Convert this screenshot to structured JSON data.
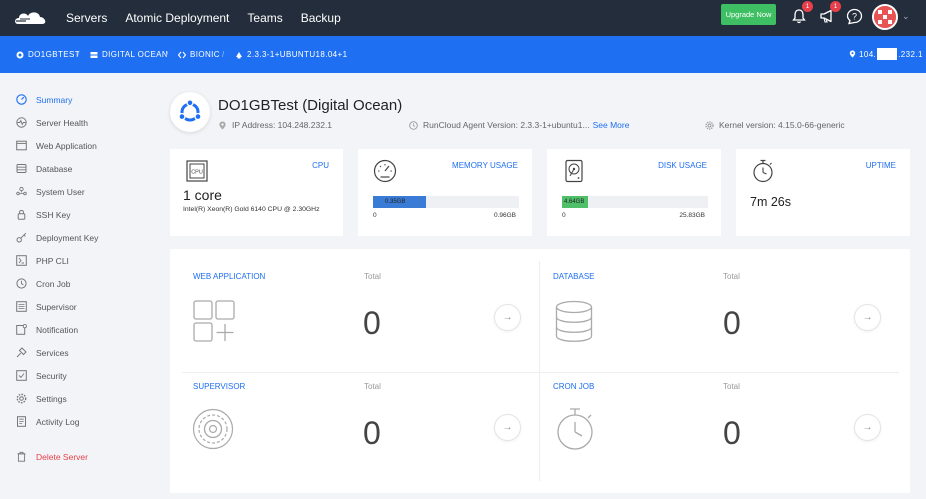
{
  "nav": {
    "links": [
      "Servers",
      "Atomic Deployment",
      "Teams",
      "Backup"
    ],
    "upgrade_label": "Upgrade Now",
    "notif_badge": "1",
    "announce_badge": "1",
    "icons": [
      "bell-icon",
      "megaphone-icon",
      "help-icon",
      "avatar",
      "chevron-down-icon"
    ]
  },
  "breadcrumb": {
    "server": "DO1GBTEST",
    "provider": "DIGITAL OCEAN",
    "os": "BIONIC",
    "agent": "2.3.3-1+UBUNTU18.04+1",
    "ip_prefix": "104.",
    "ip_suffix": ".232.1"
  },
  "sidebar": {
    "items": [
      {
        "label": "Summary",
        "icon": "gauge-icon"
      },
      {
        "label": "Server Health",
        "icon": "heartbeat-icon"
      },
      {
        "label": "Web Application",
        "icon": "browser-icon"
      },
      {
        "label": "Database",
        "icon": "database-icon"
      },
      {
        "label": "System User",
        "icon": "users-icon"
      },
      {
        "label": "SSH Key",
        "icon": "lock-icon"
      },
      {
        "label": "Deployment Key",
        "icon": "key-icon"
      },
      {
        "label": "PHP CLI",
        "icon": "php-icon"
      },
      {
        "label": "Cron Job",
        "icon": "clock-icon"
      },
      {
        "label": "Supervisor",
        "icon": "list-icon"
      },
      {
        "label": "Notification",
        "icon": "notification-icon"
      },
      {
        "label": "Services",
        "icon": "plug-icon"
      },
      {
        "label": "Security",
        "icon": "shield-icon"
      },
      {
        "label": "Settings",
        "icon": "gear-icon"
      },
      {
        "label": "Activity Log",
        "icon": "log-icon"
      }
    ],
    "delete_label": "Delete Server"
  },
  "server": {
    "title": "DO1GBTest (Digital Ocean)",
    "ip": "IP Address: 104.248.232.1",
    "agent_version": "RunCloud Agent Version: 2.3.3-1+ubuntu1...",
    "see_more": "See More",
    "kernel": "Kernel version: 4.15.0-66-generic"
  },
  "cards": {
    "cpu": {
      "title": "CPU",
      "value": "1 core",
      "detail": "Intel(R) Xeon(R) Gold 6140 CPU @ 2.30GHz"
    },
    "memory": {
      "title": "MEMORY USAGE",
      "used": "0.35GB",
      "min": "0",
      "max": "0.96GB",
      "fraction": 0.36,
      "color": "#3a7bd5"
    },
    "disk": {
      "title": "DISK USAGE",
      "used": "4.64GB",
      "min": "0",
      "max": "25.83GB",
      "fraction": 0.18,
      "color": "#4fbf6a"
    },
    "uptime": {
      "title": "UPTIME",
      "value": "7m 26s"
    }
  },
  "panel": {
    "total_label": "Total",
    "webapp": {
      "title": "WEB APPLICATION",
      "count": "0"
    },
    "database": {
      "title": "DATABASE",
      "count": "0"
    },
    "supervisor": {
      "title": "SUPERVISOR",
      "count": "0"
    },
    "cronjob": {
      "title": "CRON JOB",
      "count": "0"
    }
  },
  "colors": {
    "accent": "#1e6ff2",
    "topbar": "#232d3b",
    "danger": "#e8404a",
    "success": "#3fbf63"
  }
}
